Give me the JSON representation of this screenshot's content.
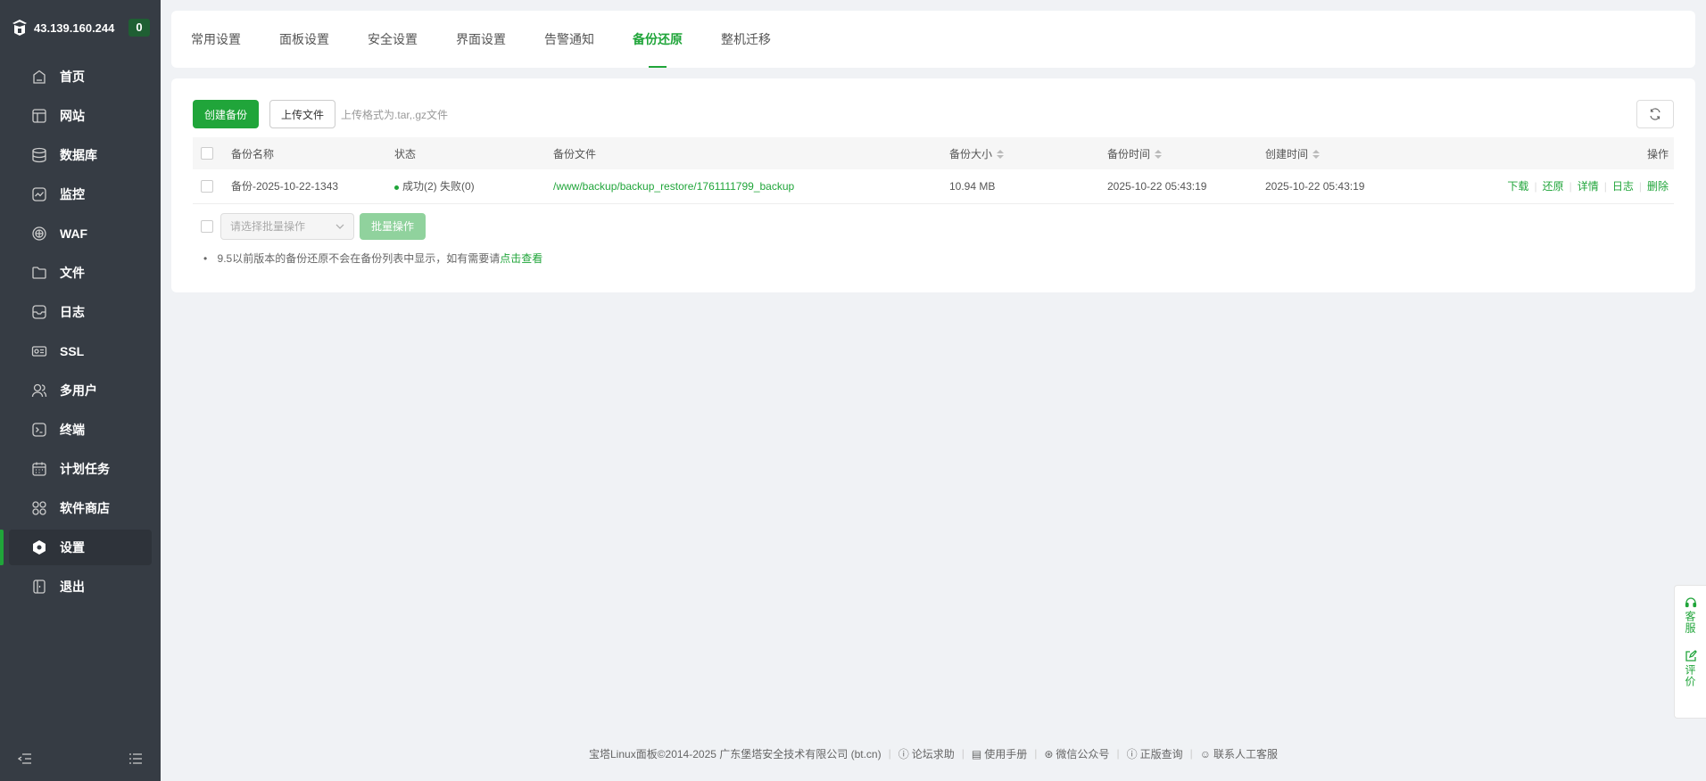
{
  "sidebar": {
    "ip": "43.139.160.244",
    "badge": "0",
    "items": [
      {
        "label": "首页",
        "icon": "home-icon"
      },
      {
        "label": "网站",
        "icon": "website-icon"
      },
      {
        "label": "数据库",
        "icon": "database-icon"
      },
      {
        "label": "监控",
        "icon": "monitor-icon"
      },
      {
        "label": "WAF",
        "icon": "shield-icon"
      },
      {
        "label": "文件",
        "icon": "folder-icon"
      },
      {
        "label": "日志",
        "icon": "log-icon"
      },
      {
        "label": "SSL",
        "icon": "ssl-icon"
      },
      {
        "label": "多用户",
        "icon": "users-icon"
      },
      {
        "label": "终端",
        "icon": "terminal-icon"
      },
      {
        "label": "计划任务",
        "icon": "calendar-icon"
      },
      {
        "label": "软件商店",
        "icon": "apps-icon"
      },
      {
        "label": "设置",
        "icon": "gear-icon",
        "active": true
      },
      {
        "label": "退出",
        "icon": "logout-icon"
      }
    ]
  },
  "tabs": [
    "常用设置",
    "面板设置",
    "安全设置",
    "界面设置",
    "告警通知",
    "备份还原",
    "整机迁移"
  ],
  "active_tab": 5,
  "toolbar": {
    "create_label": "创建备份",
    "upload_label": "上传文件",
    "hint": "上传格式为.tar,.gz文件"
  },
  "table": {
    "headers": {
      "name": "备份名称",
      "status": "状态",
      "file": "备份文件",
      "size": "备份大小",
      "backup_time": "备份时间",
      "create_time": "创建时间",
      "ops": "操作"
    },
    "rows": [
      {
        "name": "备份-2025-10-22-1343",
        "status": "成功(2) 失败(0)",
        "file": "/www/backup/backup_restore/1761111799_backup",
        "size": "10.94 MB",
        "backup_time": "2025-10-22 05:43:19",
        "create_time": "2025-10-22 05:43:19",
        "ops": [
          "下载",
          "还原",
          "详情",
          "日志",
          "删除"
        ]
      }
    ]
  },
  "batch": {
    "placeholder": "请选择批量操作",
    "button": "批量操作"
  },
  "note": {
    "text": "9.5以前版本的备份还原不会在备份列表中显示，如有需要请",
    "link": "点击查看"
  },
  "footer": {
    "copyright": "宝塔Linux面板©2014-2025 广东堡塔安全技术有限公司 (bt.cn)",
    "links": [
      "论坛求助",
      "使用手册",
      "微信公众号",
      "正版查询",
      "联系人工客服"
    ]
  },
  "float": {
    "service": "客服",
    "review": "评价"
  },
  "colors": {
    "accent": "#20a53a",
    "sidebar_bg": "#363c44"
  }
}
